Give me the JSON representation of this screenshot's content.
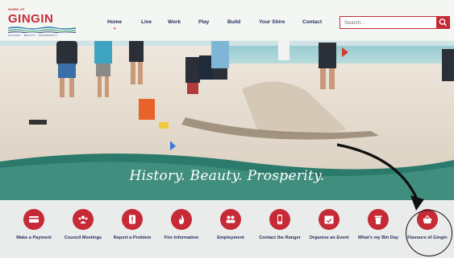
{
  "header": {
    "logo": {
      "shire_text": "SHIRE OF",
      "name": "GINGIN",
      "tagline": "HISTORY · BEAUTY · PROSPERITY"
    },
    "nav": [
      {
        "label": "Home"
      },
      {
        "label": "Live"
      },
      {
        "label": "Work"
      },
      {
        "label": "Play"
      },
      {
        "label": "Build"
      },
      {
        "label": "Your Shire"
      },
      {
        "label": "Contact"
      }
    ],
    "search": {
      "placeholder": "Search..."
    }
  },
  "hero": {
    "tagline": "History. Beauty. Prosperity."
  },
  "quick_links": [
    {
      "label": "Make a Payment",
      "icon": "credit-card-icon"
    },
    {
      "label": "Council Meetings",
      "icon": "people-group-icon"
    },
    {
      "label": "Report a Problem",
      "icon": "report-icon"
    },
    {
      "label": "Fire Information",
      "icon": "flame-icon"
    },
    {
      "label": "Employment",
      "icon": "people-icon"
    },
    {
      "label": "Contact the Ranger",
      "icon": "phone-icon"
    },
    {
      "label": "Organise an Event",
      "icon": "calendar-icon"
    },
    {
      "label": "What's my Bin Day",
      "icon": "bin-icon"
    },
    {
      "label": "Flavours of Gingin",
      "icon": "basket-icon"
    }
  ],
  "colors": {
    "brand_red": "#c62a36",
    "navy": "#24305e",
    "teal": "#2c7a6c"
  }
}
